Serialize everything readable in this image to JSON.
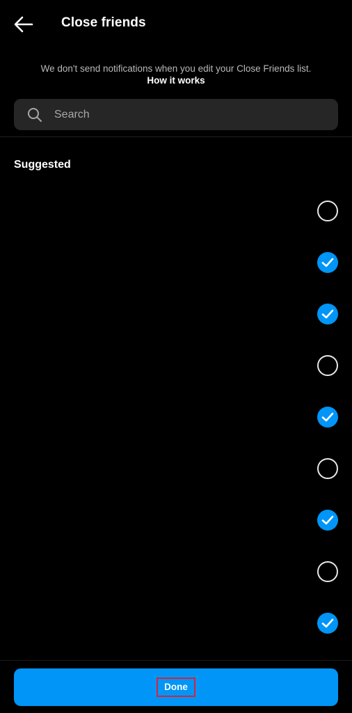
{
  "header": {
    "title": "Close friends",
    "back_icon": "arrow-left-icon"
  },
  "notice": {
    "text": "We don't send notifications when you edit your Close Friends list.",
    "link": "How it works"
  },
  "search": {
    "placeholder": "Search",
    "value": "",
    "icon": "search-icon"
  },
  "section": {
    "label": "Suggested"
  },
  "friends": [
    {
      "selected": false
    },
    {
      "selected": true
    },
    {
      "selected": true
    },
    {
      "selected": false
    },
    {
      "selected": true
    },
    {
      "selected": false
    },
    {
      "selected": true
    },
    {
      "selected": false
    },
    {
      "selected": true
    }
  ],
  "footer": {
    "done_label": "Done"
  },
  "colors": {
    "accent": "#0095f6",
    "background": "#000000",
    "search_bg": "#262626",
    "highlight_border": "#d6243a"
  }
}
